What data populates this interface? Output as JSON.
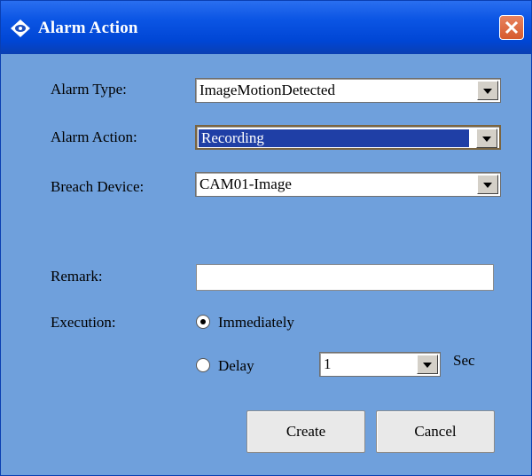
{
  "window": {
    "title": "Alarm Action",
    "icon": "eye-diamond-icon",
    "close_icon": "close-icon"
  },
  "form": {
    "alarm_type": {
      "label": "Alarm Type:",
      "value": "ImageMotionDetected"
    },
    "alarm_action": {
      "label": "Alarm Action:",
      "value": "Recording"
    },
    "breach_device": {
      "label": "Breach Device:",
      "value": "CAM01-Image"
    },
    "remark": {
      "label": "Remark:",
      "value": ""
    },
    "execution": {
      "label": "Execution:",
      "immediately_label": "Immediately",
      "delay_label": "Delay",
      "selected": "Immediately",
      "delay_value": "1",
      "delay_unit": "Sec"
    }
  },
  "buttons": {
    "create": "Create",
    "cancel": "Cancel"
  },
  "colors": {
    "dialog_background": "#6fa0dc",
    "titlebar": "#0b55e4",
    "selection": "#1f3fa6",
    "close_button": "#d65a2e"
  }
}
